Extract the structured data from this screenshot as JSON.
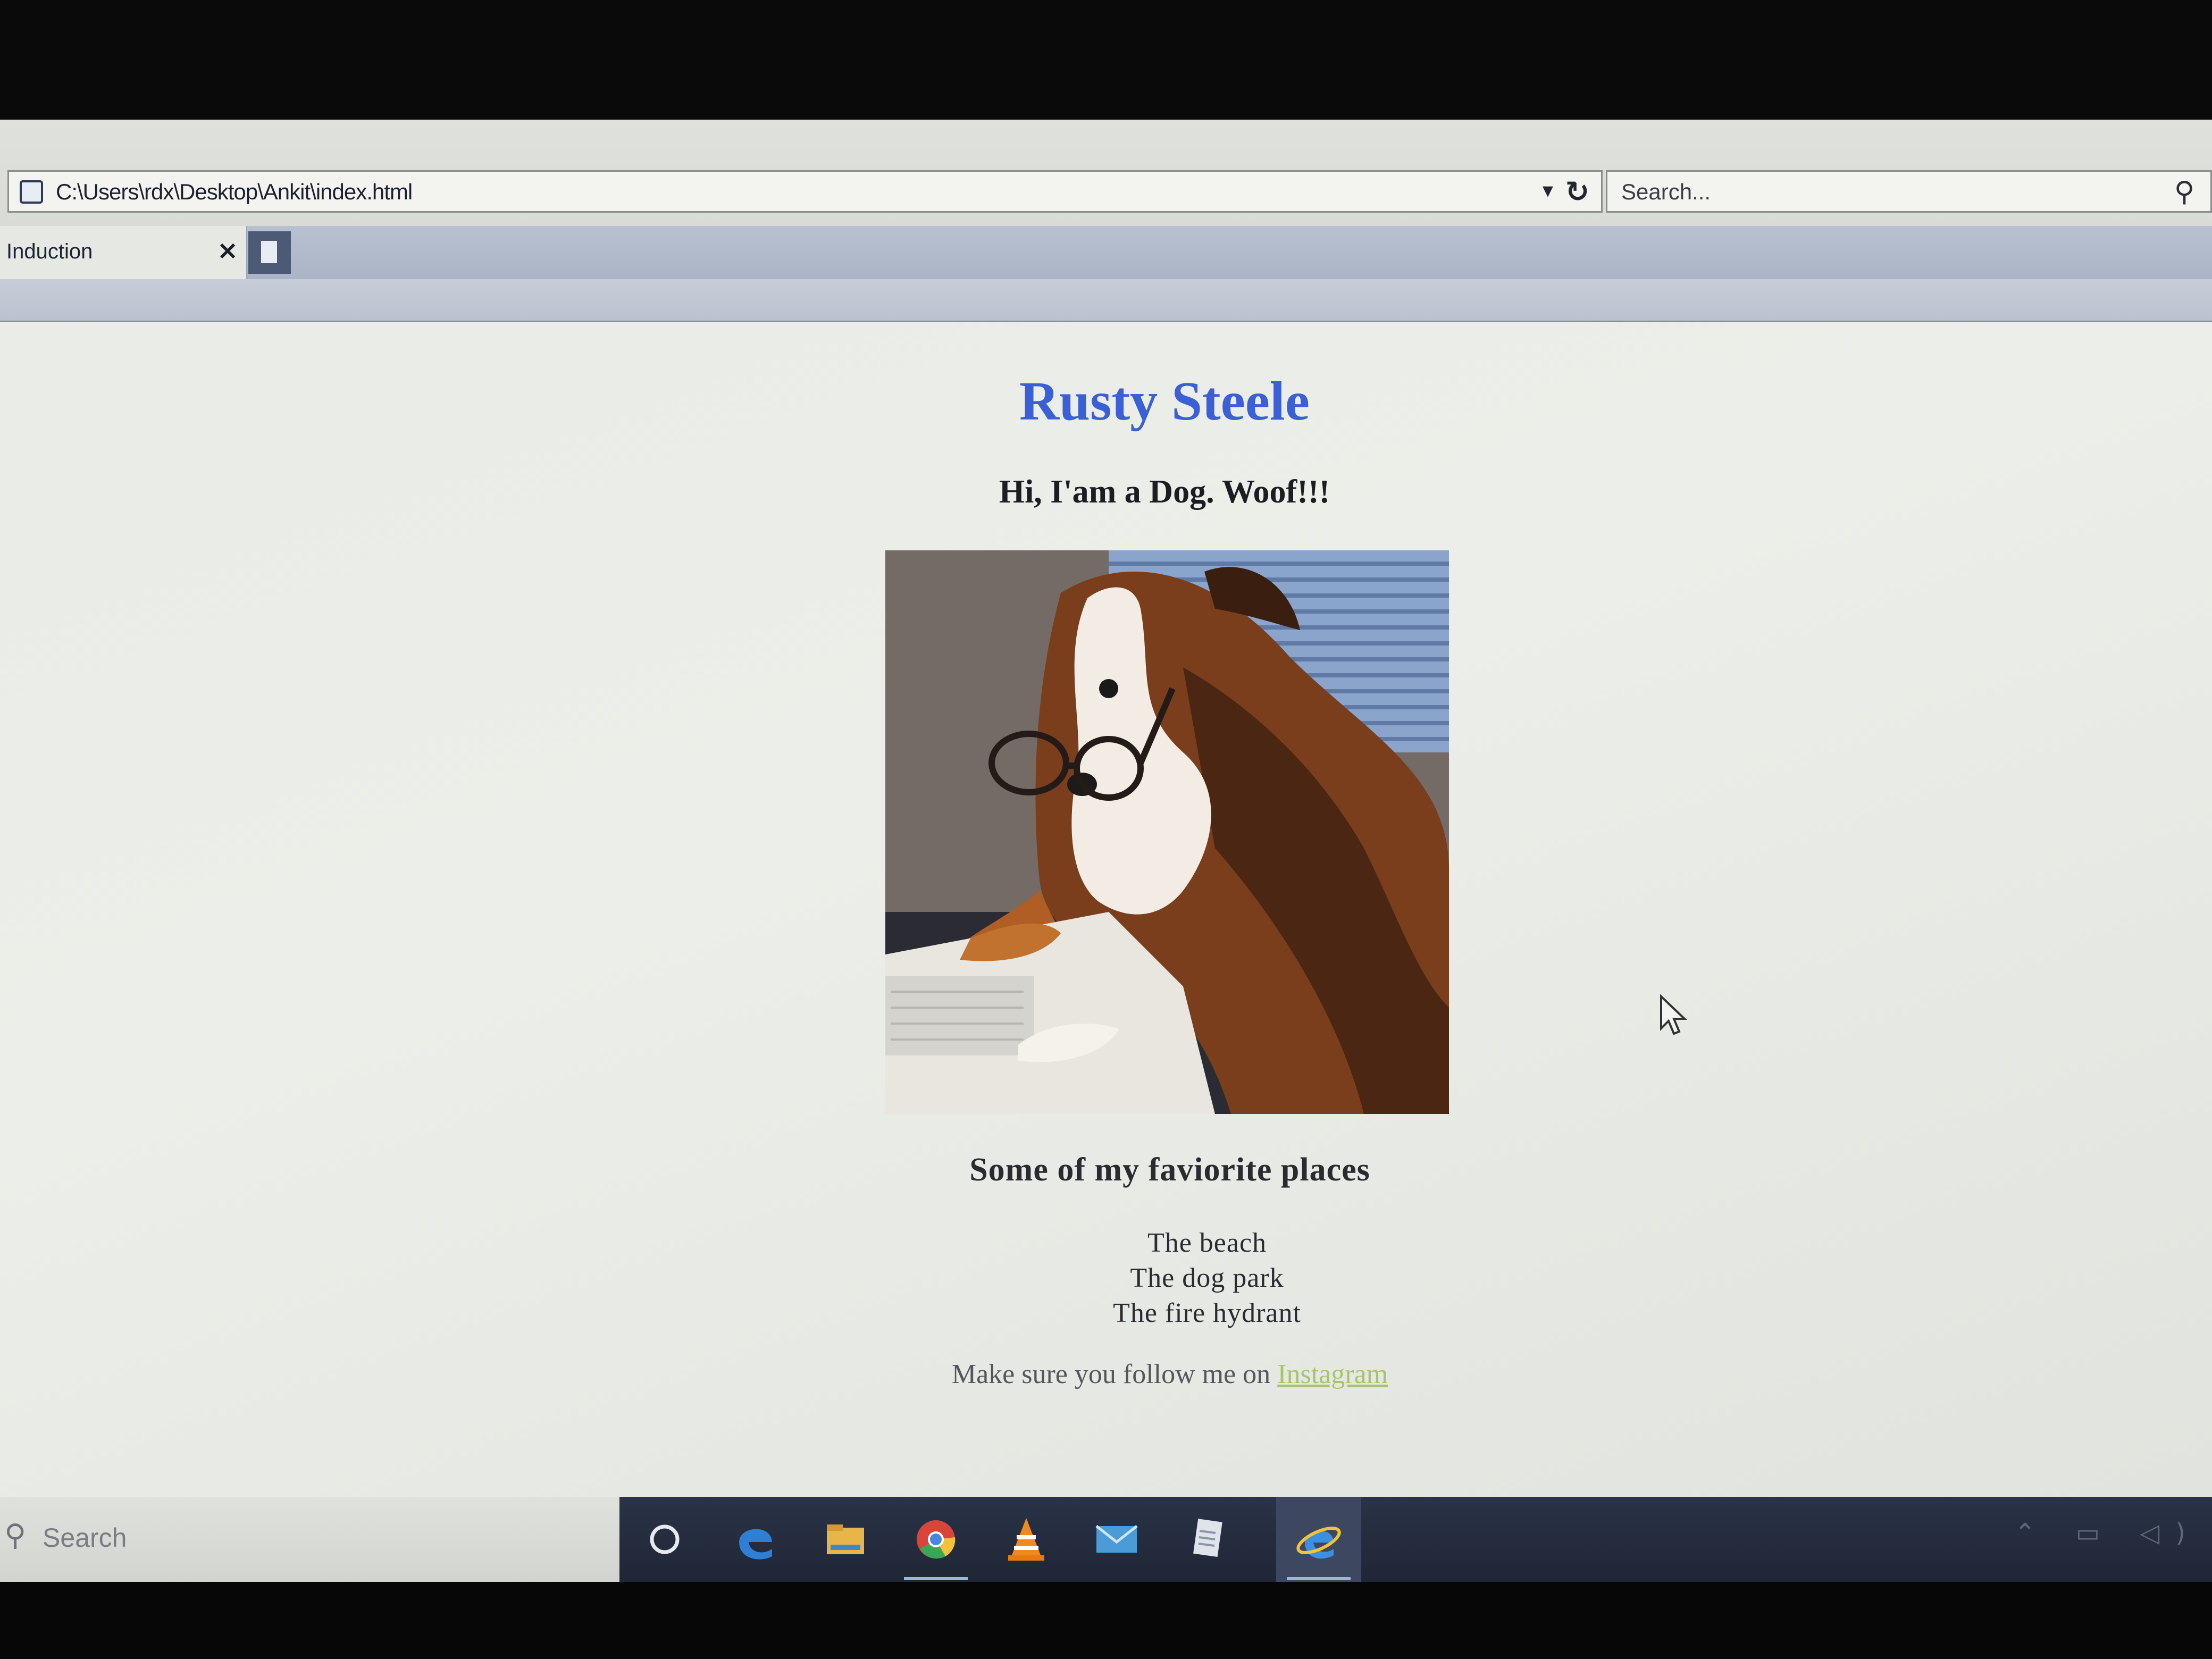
{
  "browser": {
    "address": "C:\\Users\\rdx\\Desktop\\Ankit\\index.html",
    "search_placeholder": "Search...",
    "tab_title": "Induction",
    "tab_close": "×",
    "dropdown_glyph": "▾",
    "refresh_glyph": "↻",
    "search_glyph": "⚲"
  },
  "page": {
    "title": "Rusty Steele",
    "subtitle": "Hi, I'am a Dog. Woof!!!",
    "favorites_heading": "Some of my faviorite places",
    "favorites": [
      "The beach",
      "The dog park",
      "The fire hydrant"
    ],
    "follow_text": "Make sure you follow me on ",
    "link_text": "Instagram",
    "title_color": "#3a5fd6",
    "link_color": "#a8c46a"
  },
  "taskbar": {
    "search_label": "Search",
    "apps": [
      "task-view-icon",
      "edge-icon",
      "file-explorer-icon",
      "chrome-icon",
      "vlc-icon",
      "mail-icon",
      "notepad-icon",
      "internet-explorer-icon"
    ]
  }
}
